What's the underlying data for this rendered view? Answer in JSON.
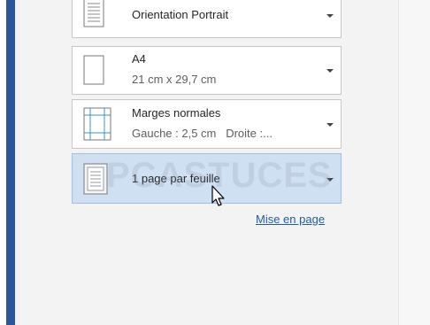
{
  "page_setup": {
    "orientation": {
      "title": "Orientation Portrait"
    },
    "paper_size": {
      "title": "A4",
      "subtitle": "21 cm x 29,7 cm"
    },
    "margins": {
      "title": "Marges normales",
      "subtitle": "Gauche : 2,5 cm   Droite :..."
    },
    "pages_per_sheet": {
      "title": "1 page par feuille",
      "selected": true
    },
    "link_label": "Mise en page"
  },
  "watermark": {
    "text": "PCASTUCES"
  },
  "colors": {
    "accent_rail": "#2b579a",
    "selected_background": "#cfe0f2",
    "link": "#1f5ba8"
  }
}
